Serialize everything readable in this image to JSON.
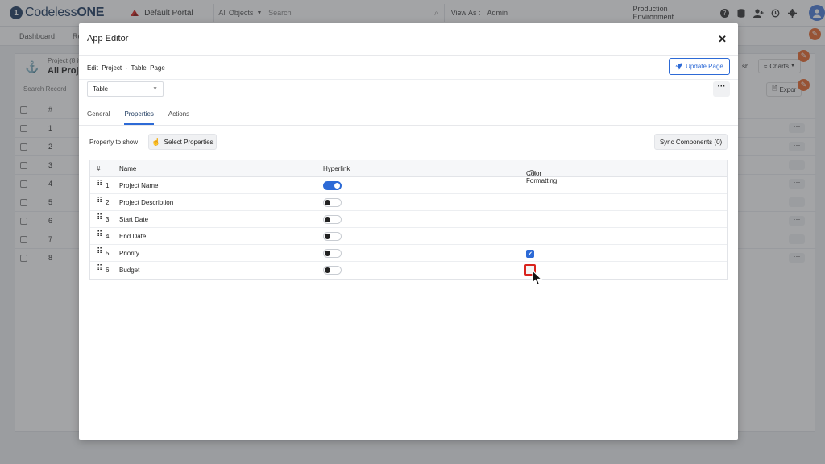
{
  "topbar": {
    "logo_text_light": "Codeless",
    "logo_text_bold": "ONE",
    "portal_name": "Default Portal",
    "objects_select": "All Objects",
    "search_placeholder": "Search",
    "view_as_label": "View As :",
    "view_as_value": "Admin",
    "environment": "Production Environment",
    "icons": [
      "help-icon",
      "database-icon",
      "add-user-icon",
      "history-icon",
      "settings-icon",
      "user-avatar-icon"
    ]
  },
  "navbar": {
    "items": [
      "Dashboard",
      "Re"
    ]
  },
  "background_page": {
    "object_label": "Project (8 it",
    "view_title": "All Proje",
    "search_label": "Search Record",
    "refresh_label": "sh",
    "charts_label": "Charts",
    "export_label": "Expor",
    "column_num": "#",
    "row_numbers": [
      "1",
      "2",
      "3",
      "4",
      "5",
      "6",
      "7",
      "8"
    ]
  },
  "modal": {
    "title": "App Editor",
    "breadcrumb": "Edit  Project  -  Table  Page",
    "update_button": "Update Page",
    "type_select": "Table",
    "tabs": [
      "General",
      "Properties",
      "Actions"
    ],
    "active_tab": "Properties",
    "property_to_show_label": "Property to show",
    "select_properties_button": "Select Properties",
    "sync_button": "Sync Components (0)",
    "table": {
      "headers": {
        "num": "#",
        "name": "Name",
        "hyperlink": "Hyperlink",
        "color_formatting": "Color Formatting"
      },
      "rows": [
        {
          "idx": "1",
          "name": "Project Name",
          "hyperlink": true,
          "color_formatting": false
        },
        {
          "idx": "2",
          "name": "Project Description",
          "hyperlink": false,
          "color_formatting": false
        },
        {
          "idx": "3",
          "name": "Start Date",
          "hyperlink": false,
          "color_formatting": false
        },
        {
          "idx": "4",
          "name": "End Date",
          "hyperlink": false,
          "color_formatting": false
        },
        {
          "idx": "5",
          "name": "Priority",
          "hyperlink": false,
          "color_formatting": true
        },
        {
          "idx": "6",
          "name": "Budget",
          "hyperlink": false,
          "color_formatting": false
        }
      ]
    }
  },
  "colors": {
    "accent": "#2d6ad6",
    "brand": "#1f3b60",
    "highlight": "#d9231d",
    "fab": "#e8662a"
  }
}
